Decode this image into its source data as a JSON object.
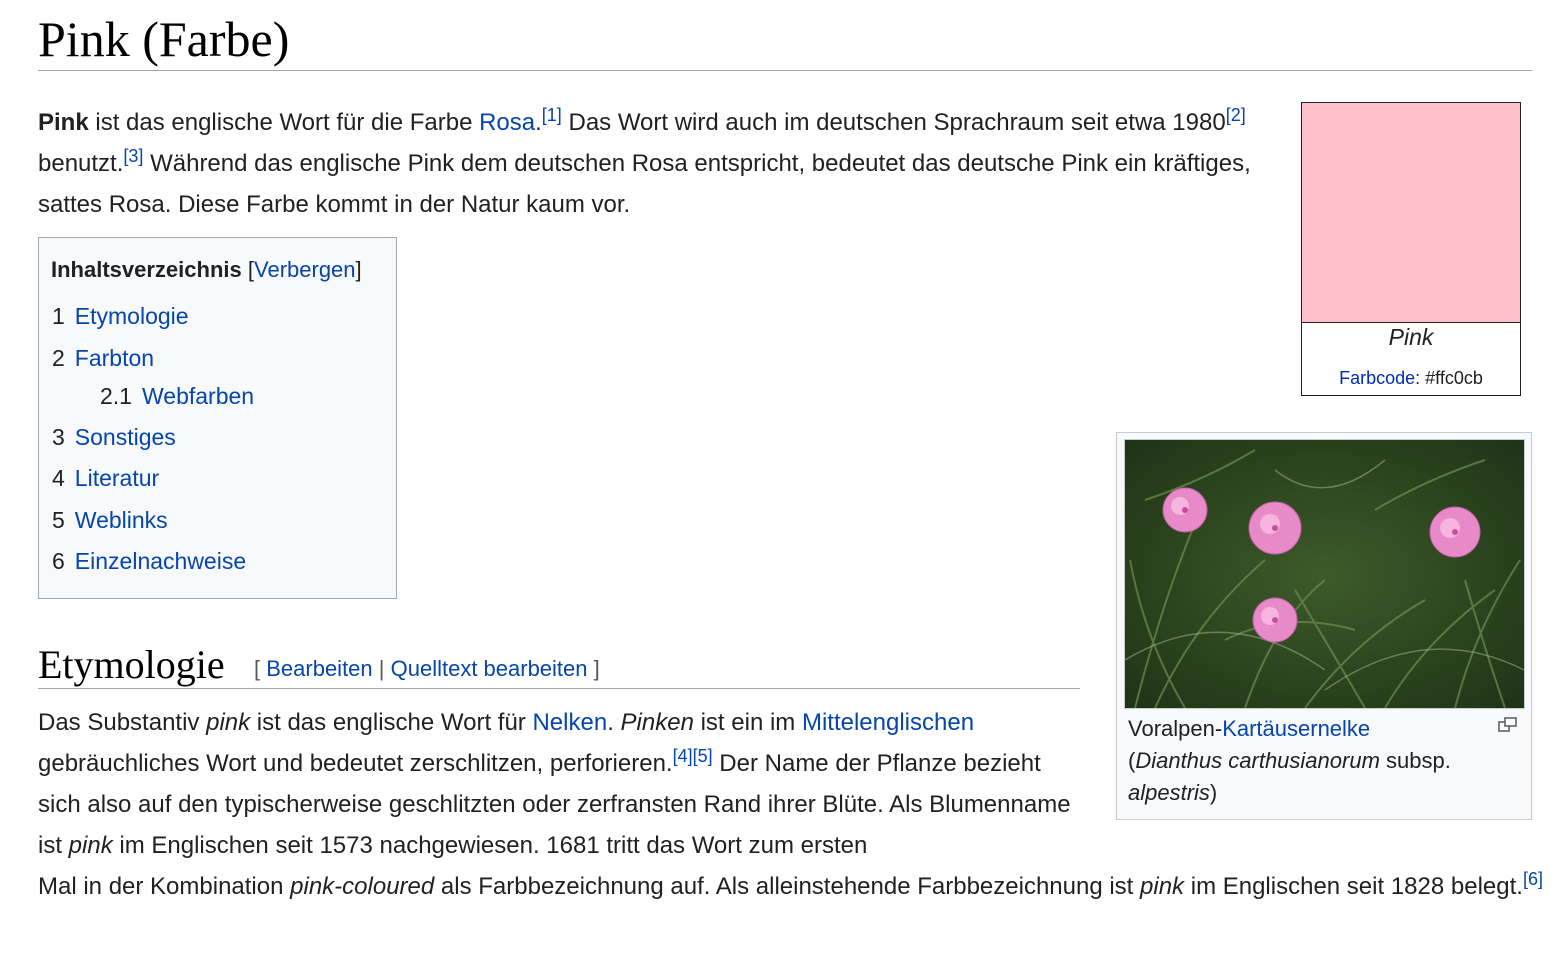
{
  "title": "Pink (Farbe)",
  "intro": {
    "bold": "Pink",
    "t1": " ist das englische Wort für die Farbe ",
    "link_rosa": "Rosa",
    "t2": ".",
    "ref1": "[1]",
    "t3": " Das Wort wird auch im deutschen Sprachraum seit etwa 1980",
    "ref2": "[2]",
    "t4": " benutzt.",
    "ref3": "[3]",
    "t5": " Während das englische Pink dem deutschen Rosa entspricht, bedeutet das deutsche Pink ein kräftiges, sattes Rosa. Diese Farbe kommt in der Natur kaum vor."
  },
  "toc": {
    "title": "Inhaltsverzeichnis",
    "bracket_open": "[",
    "toggle": "Verbergen",
    "bracket_close": "]",
    "items": [
      {
        "num": "1",
        "label": "Etymologie"
      },
      {
        "num": "2",
        "label": "Farbton"
      },
      {
        "num": "2.1",
        "label": "Webfarben"
      },
      {
        "num": "3",
        "label": "Sonstiges"
      },
      {
        "num": "4",
        "label": "Literatur"
      },
      {
        "num": "5",
        "label": "Weblinks"
      },
      {
        "num": "6",
        "label": "Einzelnachweise"
      }
    ]
  },
  "section": {
    "heading": "Etymologie",
    "edit_open": "[ ",
    "edit": "Bearbeiten",
    "sep": " | ",
    "edit_source": "Quelltext bearbeiten",
    "edit_close": " ]"
  },
  "etym": {
    "a1": "Das Substantiv ",
    "i_pink": "pink",
    "a2": " ist das englische Wort für ",
    "link_nelken": "Nelken",
    "a3": ". ",
    "i_pinken": "Pinken",
    "a4": " ist ein im ",
    "link_mittel": "Mittelenglischen",
    "a5": " gebräuchliches Wort und bedeutet zerschlitzen, perforieren.",
    "ref4": "[4]",
    "ref5": "[5]",
    "a6": " Der Name der Pflanze bezieht sich also auf den typischerweise geschlitzten oder zerfransten Rand ihrer Blüte. Als Blumenname ist ",
    "i_pink2": "pink",
    "a7": " im Englischen seit 1573 nachgewiesen. 1681 tritt das Wort zum ersten",
    "b1": "Mal in der Kombination ",
    "i_coloured": "pink-coloured",
    "b2": " als Farbbezeichnung auf. Als alleinstehende Farbbezeichnung ist ",
    "i_pink3": "pink",
    "b3": " im Englischen seit 1828 belegt.",
    "ref6": "[6]"
  },
  "colorbox": {
    "name": "Pink",
    "code_label": "Farbcode",
    "code_value": ": #ffc0cb",
    "swatch_color": "#ffc0cb"
  },
  "thumb": {
    "c1": "Voralpen-",
    "link_kart": "Kartäusernelke",
    "c2": "(",
    "i_dianthus": "Dianthus carthusianorum",
    "c3": " subsp. ",
    "i_alpestris": "alpestris",
    "c4": ")",
    "icon": "magnify-icon"
  }
}
